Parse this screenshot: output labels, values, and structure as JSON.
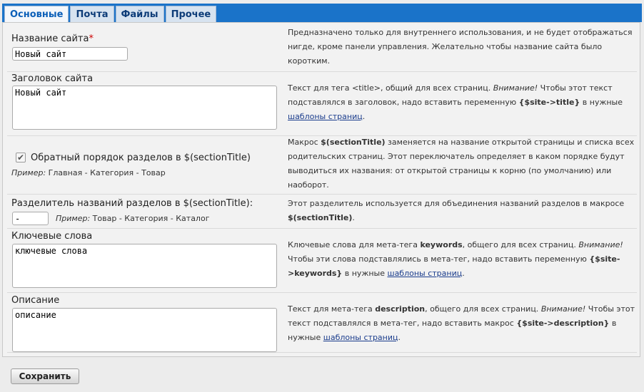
{
  "tabs": [
    "Основные",
    "Почта",
    "Файлы",
    "Прочее"
  ],
  "fields": {
    "site_name": {
      "label": "Название сайта",
      "required_mark": "*",
      "value": "Новый сайт",
      "help": "Предназначено только для внутреннего использования, и не будет отображаться нигде, кроме панели управления. Желательно чтобы название сайта было коротким."
    },
    "site_title": {
      "label": "Заголовок сайта",
      "value": "Новый сайт",
      "help_pre": "Текст для тега <title>, общий для всех страниц. ",
      "help_em": "Внимание!",
      "help_mid": " Чтобы этот текст подставлялся в заголовок, надо вставить переменную ",
      "help_code": "{$site->title}",
      "help_mid2": " в нужные ",
      "help_link": "шаблоны страниц",
      "help_end": "."
    },
    "reverse_order": {
      "label": "Обратный порядок разделов в $(sectionTitle)",
      "checked": true,
      "example_label": "Пример:",
      "example_value": " Главная - Категория - Товар",
      "help_pre": "Макрос ",
      "help_code": "$(sectionTitle)",
      "help_rest": " заменяется на название открытой страницы и списка всех родительских страниц. Этот переключатель определяет в каком порядке будут выводиться их названия: от открытой страницы к корню (по умолчанию) или наоборот."
    },
    "separator": {
      "label": "Разделитель названий разделов в $(sectionTitle):",
      "value": "-",
      "example_label": "Пример:",
      "example_value": " Товар - Категория - Каталог",
      "help_pre": "Этот разделитель используется для объединения названий разделов в макросе ",
      "help_code": "$(sectionTitle)",
      "help_end": "."
    },
    "keywords": {
      "label": "Ключевые слова",
      "value": "ключевые слова",
      "help_pre": "Ключевые слова для мета-тега ",
      "help_b": "keywords",
      "help_mid": ", общего для всех страниц. ",
      "help_em": "Внимание!",
      "help_mid2": " Чтобы эти слова подставлялись в мета-тег, надо вставить переменную ",
      "help_code": "{$site->keywords}",
      "help_mid3": " в нужные ",
      "help_link": "шаблоны страниц",
      "help_end": "."
    },
    "description": {
      "label": "Описание",
      "value": "описание",
      "help_pre": "Текст для мета-тега ",
      "help_b": "description",
      "help_mid": ", общего для всех страниц. ",
      "help_em": "Внимание!",
      "help_mid2": " Чтобы этот текст подставлялся в мета-тег, надо вставить макрос ",
      "help_code": "{$site->description}",
      "help_mid3": " в нужные ",
      "help_link": "шаблоны страниц",
      "help_end": "."
    }
  },
  "save_label": "Сохранить",
  "colors": {
    "tab_bar": "#1a73c9",
    "required": "#cc0000",
    "link": "#1a3c8c"
  }
}
